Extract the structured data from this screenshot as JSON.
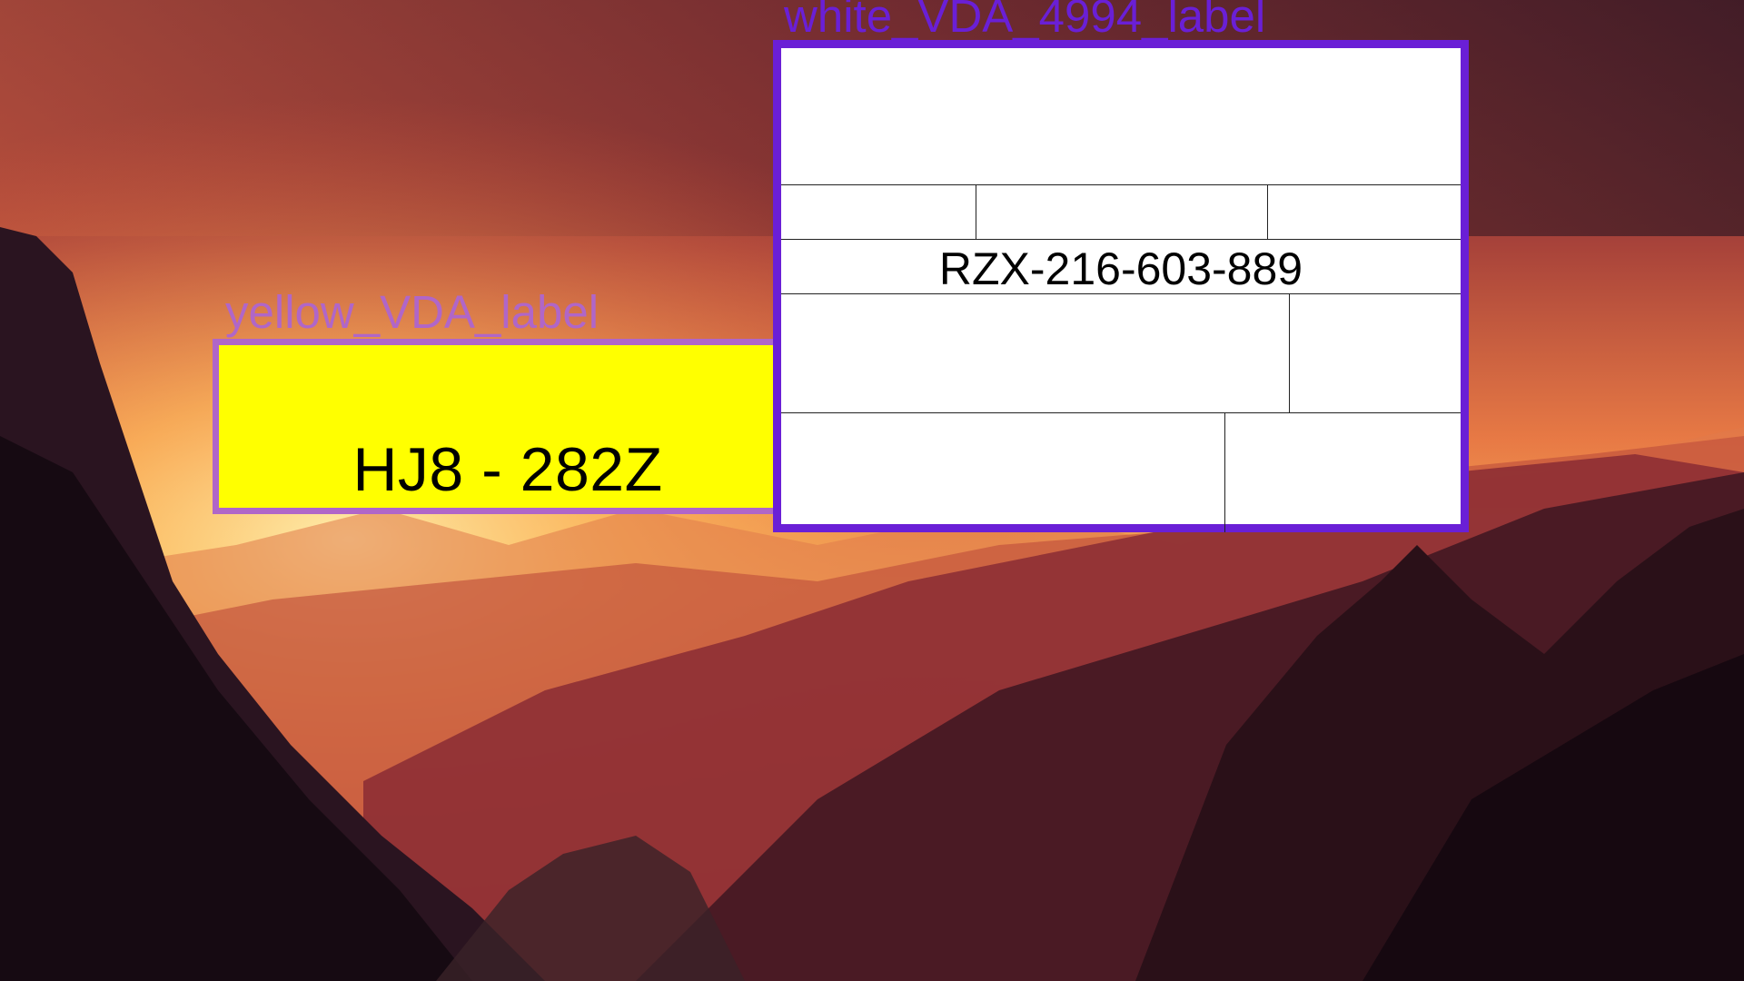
{
  "background": {
    "description_icon": "mountain-sunset-wallpaper",
    "colors": {
      "sky_top": "#3c1a2a",
      "glow": "#ffd070",
      "haze": "#e0602f",
      "mountain_dark": "#1a0d14"
    }
  },
  "yellow_label": {
    "caption": "yellow_VDA_label",
    "text": "HJ8 - 282Z",
    "fill_color": "#ffff00",
    "frame_color": "#b066c8"
  },
  "white_label": {
    "caption": "white_VDA_4994_label",
    "code": "RZX-216-603-889",
    "fill_color": "#ffffff",
    "frame_color": "#6a1fd6"
  }
}
